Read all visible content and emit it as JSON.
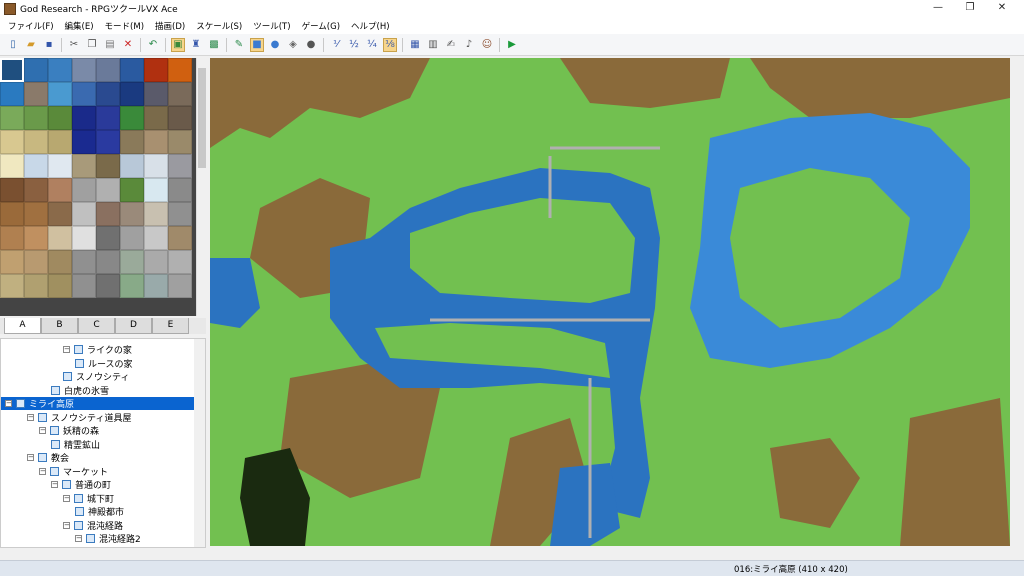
{
  "window": {
    "title": "God Research - RPGツクールVX Ace",
    "minimize_glyph": "—",
    "maximize_glyph": "❐",
    "close_glyph": "✕"
  },
  "menu": [
    {
      "id": "file",
      "label": "ファイル(F)"
    },
    {
      "id": "edit",
      "label": "編集(E)"
    },
    {
      "id": "mode",
      "label": "モード(M)"
    },
    {
      "id": "draw",
      "label": "描画(D)"
    },
    {
      "id": "scale",
      "label": "スケール(S)"
    },
    {
      "id": "tools",
      "label": "ツール(T)"
    },
    {
      "id": "game",
      "label": "ゲーム(G)"
    },
    {
      "id": "help",
      "label": "ヘルプ(H)"
    }
  ],
  "toolbar": {
    "buttons": [
      {
        "name": "new-project-icon",
        "glyph": "▯",
        "color": "#3366aa"
      },
      {
        "name": "open-project-icon",
        "glyph": "▰",
        "color": "#d49a2a"
      },
      {
        "name": "save-project-icon",
        "glyph": "▪",
        "color": "#3355aa"
      },
      {
        "sep": true
      },
      {
        "name": "cut-icon",
        "glyph": "✂",
        "color": "#555555"
      },
      {
        "name": "copy-icon",
        "glyph": "❐",
        "color": "#555555"
      },
      {
        "name": "paste-icon",
        "glyph": "▤",
        "color": "#777777"
      },
      {
        "name": "delete-icon",
        "glyph": "✕",
        "color": "#cc2222"
      },
      {
        "sep": true
      },
      {
        "name": "undo-icon",
        "glyph": "↶",
        "color": "#2a8a4a"
      },
      {
        "sep": true
      },
      {
        "name": "map-mode-icon",
        "glyph": "▣",
        "color": "#3a8a3a",
        "active": true
      },
      {
        "name": "event-mode-icon",
        "glyph": "♜",
        "color": "#3355aa"
      },
      {
        "name": "region-mode-icon",
        "glyph": "▩",
        "color": "#2a8a4a"
      },
      {
        "sep": true
      },
      {
        "name": "pencil-icon",
        "glyph": "✎",
        "color": "#2a8a4a"
      },
      {
        "name": "rectangle-icon",
        "glyph": "■",
        "color": "#3a7ad0",
        "active": true
      },
      {
        "name": "ellipse-icon",
        "glyph": "●",
        "color": "#3a7ad0"
      },
      {
        "name": "fill-icon",
        "glyph": "◈",
        "color": "#666666"
      },
      {
        "name": "shadow-pen-icon",
        "glyph": "●",
        "color": "#555555"
      },
      {
        "sep": true
      },
      {
        "name": "scale-1-1-icon",
        "glyph": "⅟",
        "color": "#3355aa"
      },
      {
        "name": "scale-1-2-icon",
        "glyph": "½",
        "color": "#3355aa"
      },
      {
        "name": "scale-1-4-icon",
        "glyph": "¼",
        "color": "#3355aa"
      },
      {
        "name": "scale-1-8-icon",
        "glyph": "⅛",
        "color": "#3355aa",
        "active": true
      },
      {
        "sep": true
      },
      {
        "name": "database-icon",
        "glyph": "▦",
        "color": "#3355aa"
      },
      {
        "name": "resource-manager-icon",
        "glyph": "▥",
        "color": "#555555"
      },
      {
        "name": "script-editor-icon",
        "glyph": "✍",
        "color": "#555555"
      },
      {
        "name": "sound-test-icon",
        "glyph": "♪",
        "color": "#555555"
      },
      {
        "name": "character-generator-icon",
        "glyph": "☺",
        "color": "#8a4a2a"
      },
      {
        "sep": true
      },
      {
        "name": "playtest-icon",
        "glyph": "▶",
        "color": "#1a9a3a"
      }
    ]
  },
  "palette": {
    "tiles": [
      "#1f4f7f",
      "#2f6fb0",
      "#3a7fc0",
      "#7a8aa8",
      "#6a7a9a",
      "#2a5aa0",
      "#b03010",
      "#d06010",
      "#2a7ac0",
      "#8a7a6a",
      "#4a9ad0",
      "#3a6ab0",
      "#2a4a90",
      "#1a3a80",
      "#5a5a6a",
      "#7a6a5a",
      "#7aaa5a",
      "#6a9a4a",
      "#5a8a3a",
      "#1a2a8a",
      "#2a3a9a",
      "#3a8a3a",
      "#7a6a4a",
      "#6a5a4a",
      "#d8c890",
      "#c8b880",
      "#b8a870",
      "#1a2a90",
      "#2a3aa0",
      "#8a7a5a",
      "#a89070",
      "#9a8a6a",
      "#f0e8c0",
      "#c8d8e8",
      "#e0e8f0",
      "#a89a7a",
      "#7a6a4a",
      "#b8c8d8",
      "#d8e0e8",
      "#9a9aa0",
      "#7a5030",
      "#8a6040",
      "#b08060",
      "#a0a0a0",
      "#b0b0b0",
      "#5a8a3a",
      "#d8e8f0",
      "#8a8a8a",
      "#9a6a3a",
      "#a07040",
      "#8a6a4a",
      "#c0c0c0",
      "#8a7060",
      "#9a8a7a",
      "#c8c0b0",
      "#909090",
      "#b08050",
      "#c09060",
      "#d0c0a0",
      "#e0e0e0",
      "#707070",
      "#a0a0a0",
      "#c8c8c8",
      "#a08a6a",
      "#c0a070",
      "#b89a70",
      "#a08a60",
      "#909090",
      "#888888",
      "#9aaa9a",
      "#aaaaaa",
      "#b0b0b0",
      "#c0b080",
      "#b0a070",
      "#a09060",
      "#909090",
      "#707070",
      "#88aa88",
      "#99aaaa",
      "#a0a0a0"
    ]
  },
  "tileset_tabs": [
    {
      "label": "A",
      "active": true
    },
    {
      "label": "B",
      "active": false
    },
    {
      "label": "C",
      "active": false
    },
    {
      "label": "D",
      "active": false
    },
    {
      "label": "E",
      "active": false
    }
  ],
  "map_tree": [
    {
      "label": "ライクの家",
      "depth": 4,
      "expander": "⊟",
      "selected": false
    },
    {
      "label": "ルースの家",
      "depth": 5,
      "expander": "",
      "selected": false
    },
    {
      "label": "スノウシティ",
      "depth": 4,
      "expander": "",
      "selected": false
    },
    {
      "label": "白虎の氷雪",
      "depth": 3,
      "expander": "",
      "selected": false
    },
    {
      "label": "ミライ高原",
      "depth": 0,
      "expander": "⊟",
      "selected": true
    },
    {
      "label": "スノウシティ道具屋",
      "depth": 1,
      "expander": "⊟",
      "selected": false
    },
    {
      "label": "妖精の森",
      "depth": 2,
      "expander": "⊟",
      "selected": false
    },
    {
      "label": "精霊鉱山",
      "depth": 3,
      "expander": "",
      "selected": false
    },
    {
      "label": "教会",
      "depth": 1,
      "expander": "⊟",
      "selected": false
    },
    {
      "label": "マーケット",
      "depth": 2,
      "expander": "⊟",
      "selected": false
    },
    {
      "label": "普通の町",
      "depth": 3,
      "expander": "⊟",
      "selected": false
    },
    {
      "label": "城下町",
      "depth": 4,
      "expander": "⊟",
      "selected": false
    },
    {
      "label": "神殿都市",
      "depth": 5,
      "expander": "",
      "selected": false
    },
    {
      "label": "混沌経路",
      "depth": 4,
      "expander": "⊟",
      "selected": false
    },
    {
      "label": "混沌経路2",
      "depth": 5,
      "expander": "⊟",
      "selected": false
    }
  ],
  "map_colors": {
    "grass": "#72c050",
    "dirt": "#8a6a3a",
    "water": "#2b73c0",
    "light_water": "#3a8ad8",
    "cave": "#1a2a10",
    "bridge": "#b0b0b0"
  },
  "status": {
    "map_info": "016:ミライ高原 (410 x 420)"
  }
}
